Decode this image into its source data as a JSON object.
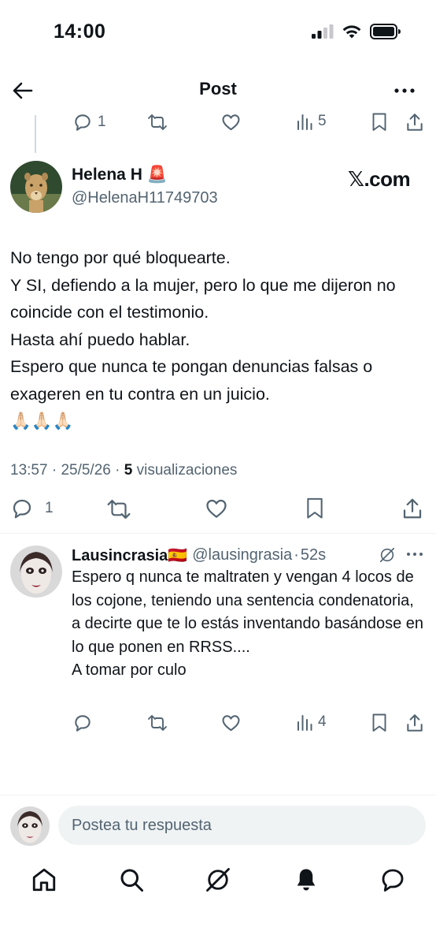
{
  "status_bar": {
    "time": "14:00"
  },
  "header": {
    "title": "Post"
  },
  "previous_post": {
    "replies": "1",
    "views": "5"
  },
  "post": {
    "author_name": "Helena H",
    "author_badge_emoji": "🚨",
    "author_handle": "@HelenaH11749703",
    "brand": "𝕏.com",
    "text": "No tengo por qué bloquearte.\nY SI, defiendo a la mujer, pero lo que me dijeron no coincide con el testimonio.\nHasta ahí puedo hablar.\nEspero que nunca te pongan denuncias falsas o exageren en tu contra en un juicio.\n🙏🏻🙏🏻🙏🏻",
    "time": "13:57",
    "date": "25/5/26",
    "views_count": "5",
    "views_label": "visualizaciones",
    "replies": "1"
  },
  "reply": {
    "author_name": "Lausincrasia",
    "flag_emoji": "🇪🇸",
    "author_handle": "@lausingrasia",
    "separator": "·",
    "time_ago": "52s",
    "text": "Espero q nunca te maltraten y vengan 4 locos de los cojone, teniendo una sentencia condenatoria, a decirte que te lo estás inventando basándose en lo que ponen en RRSS....\nA tomar por culo",
    "views": "4"
  },
  "compose": {
    "placeholder": "Postea tu respuesta"
  },
  "icons": {
    "back": "arrow-left-icon",
    "more": "more-horizontal-icon",
    "reply": "reply-icon",
    "retweet": "retweet-icon",
    "like": "heart-icon",
    "views": "bar-chart-icon",
    "bookmark": "bookmark-icon",
    "share": "share-icon",
    "grok": "grok-icon",
    "home": "home-icon",
    "search": "search-icon",
    "notifications": "bell-icon",
    "messages": "message-icon"
  },
  "colors": {
    "text": "#0f1419",
    "secondary": "#536471",
    "divider": "#eff3f4"
  }
}
